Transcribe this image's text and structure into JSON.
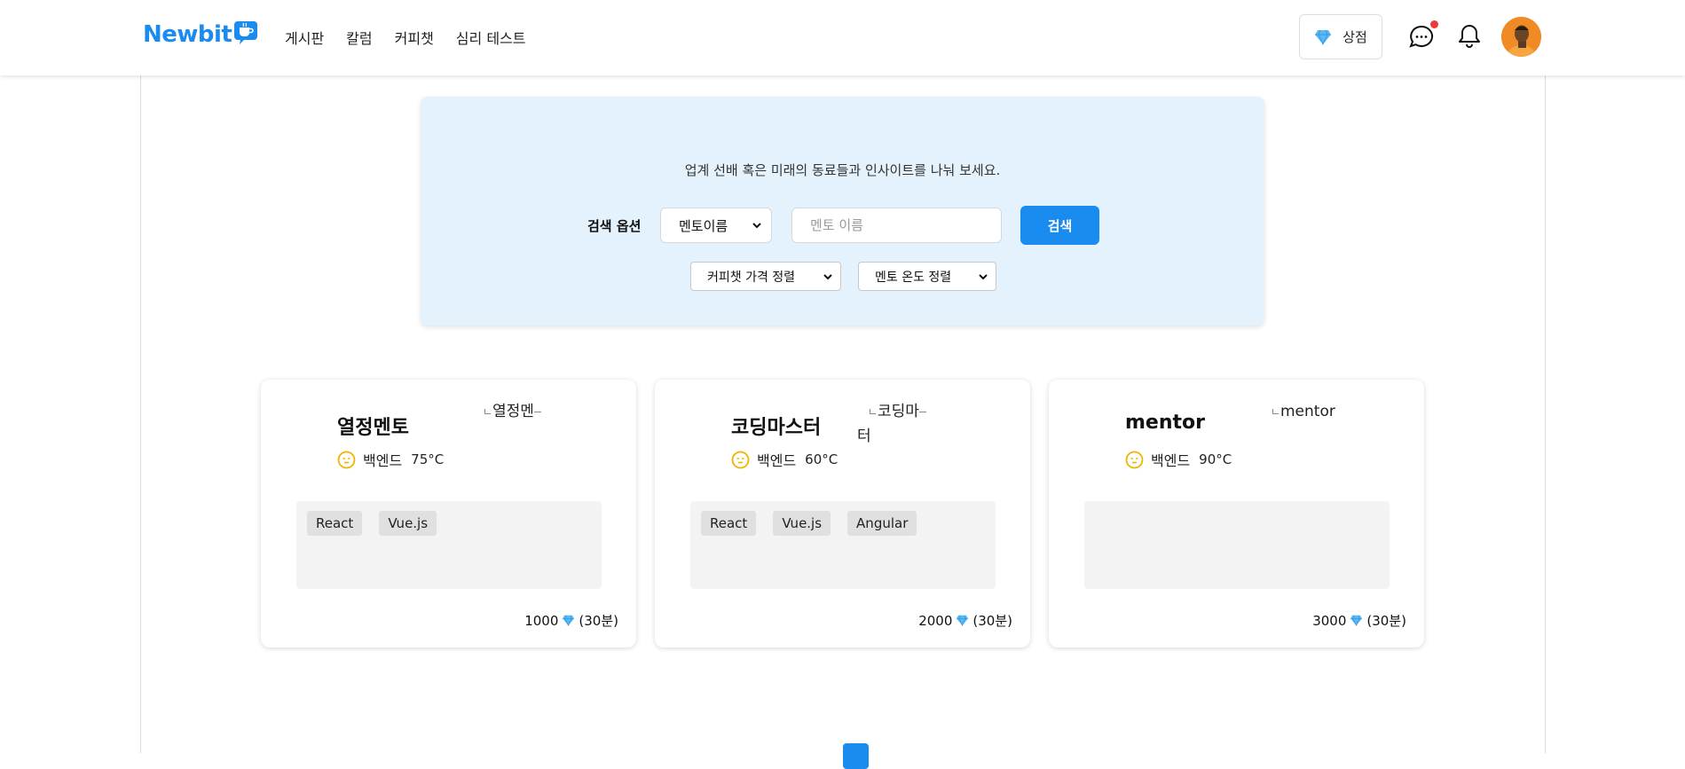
{
  "header": {
    "logo_text": "Newbit",
    "nav": [
      "게시판",
      "칼럼",
      "커피챗",
      "심리 테스트"
    ],
    "shop_label": "상점",
    "brand_color": "#1a8cf0",
    "notification_dot_color": "#f03a3a"
  },
  "hero": {
    "tagline": "업계 선배 혹은 미래의 동료들과 인사이트를 나눠 보세요.",
    "search_option_label": "검색 옵션",
    "search_option_selected": "멘토이름",
    "search_placeholder": "멘토 이름",
    "search_button": "검색",
    "sort_price_selected": "커피챗 가격 정렬",
    "sort_temp_selected": "멘토 온도 정렬",
    "background_color": "#e3f2fd"
  },
  "mentors": [
    {
      "name": "열정멘토",
      "image_alt": "열정멘",
      "image_alt_line2": "",
      "field": "백엔드",
      "temperature": "75°C",
      "tags": [
        "React",
        "Vue.js"
      ],
      "price": "1000",
      "duration": "(30분)"
    },
    {
      "name": "코딩마스터",
      "image_alt": "코딩마",
      "image_alt_line2": "터",
      "field": "백엔드",
      "temperature": "60°C",
      "tags": [
        "React",
        "Vue.js",
        "Angular"
      ],
      "price": "2000",
      "duration": "(30분)"
    },
    {
      "name": "mentor",
      "image_alt": "mentor",
      "image_alt_line2": "",
      "field": "백엔드",
      "temperature": "90°C",
      "tags": [],
      "price": "3000",
      "duration": "(30분)"
    }
  ],
  "icons": {
    "shop": "diamond-icon",
    "chat": "chat-bubble-icon",
    "notifications": "bell-icon",
    "temperature": "temperature-face-icon",
    "price": "diamond-icon"
  }
}
